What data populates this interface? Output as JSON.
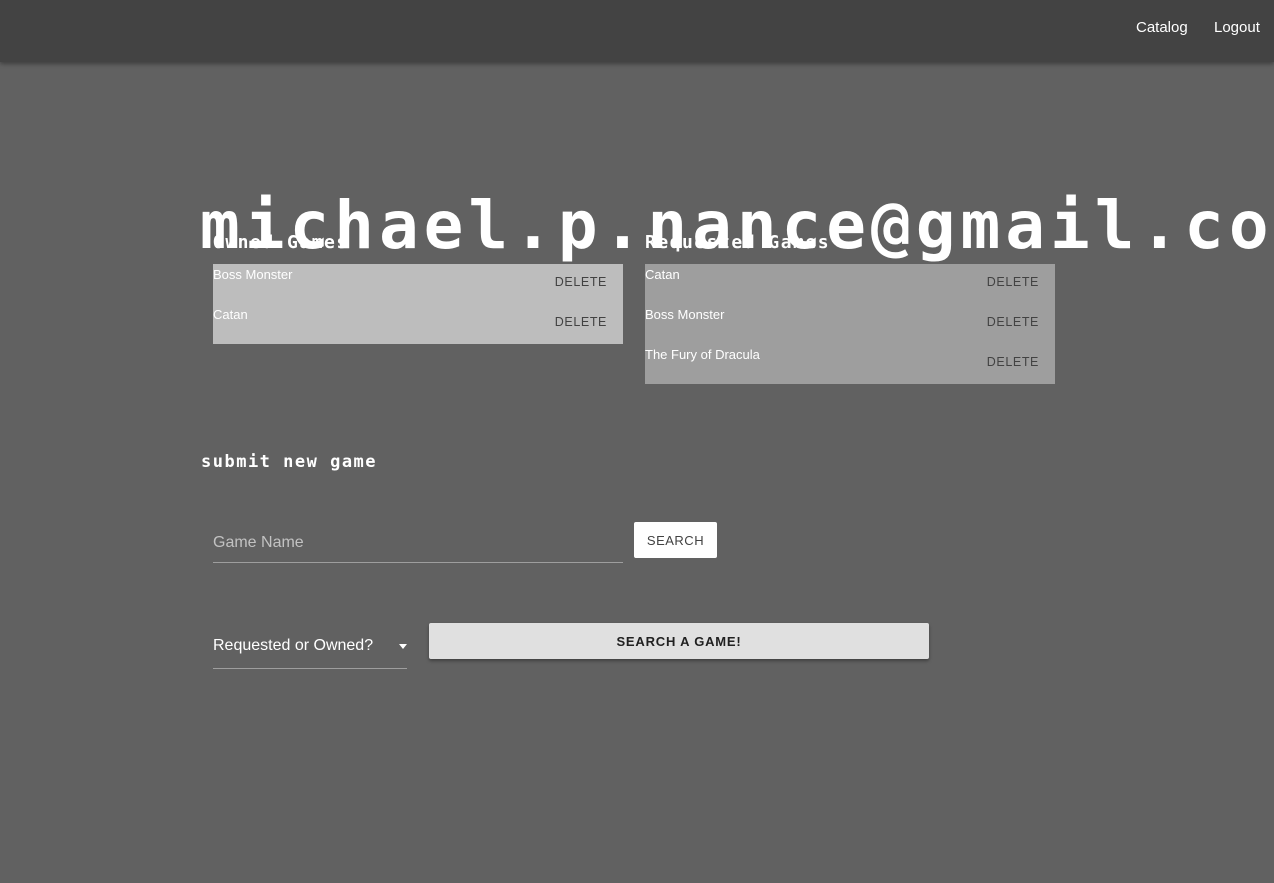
{
  "nav": {
    "catalog_label": "Catalog",
    "logout_label": "Logout"
  },
  "profile": {
    "user_title": "michael.p.nance@gmail.com"
  },
  "owned": {
    "heading": "Owned Games",
    "items": [
      {
        "name": "Boss Monster",
        "delete_label": "DELETE"
      },
      {
        "name": "Catan",
        "delete_label": "DELETE"
      }
    ]
  },
  "requested": {
    "heading": "Requested Games",
    "items": [
      {
        "name": "Catan",
        "delete_label": "DELETE"
      },
      {
        "name": "Boss Monster",
        "delete_label": "DELETE"
      },
      {
        "name": "The Fury of Dracula",
        "delete_label": "DELETE"
      }
    ]
  },
  "submit": {
    "heading": "submit new game",
    "game_name_placeholder": "Game Name",
    "search_label": "SEARCH",
    "type_select_value": "Requested or Owned?",
    "search_game_label": "SEARCH A GAME!"
  },
  "colors": {
    "background": "#616161",
    "topbar": "#434343",
    "owned_list_bg": "#bdbdbd",
    "requested_list_bg": "#9e9e9e"
  }
}
